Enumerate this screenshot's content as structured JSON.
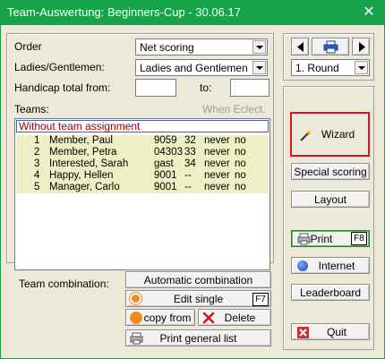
{
  "window": {
    "title": "Team-Auswertung: Beginners-Cup - 30.06.17",
    "close_glyph": "✕"
  },
  "form": {
    "order_label": "Order",
    "order_value": "Net scoring",
    "ladies_label": "Ladies/Gentlemen:",
    "ladies_value": "Ladies and Gentlemen",
    "handicap_label": "Handicap total from:",
    "handicap_from": "",
    "to_label": "to:",
    "handicap_to": "",
    "teams_label": "Teams:",
    "when_eclect_label": "When Eclect."
  },
  "teams_list": {
    "header": "Without team assignment",
    "rows": [
      {
        "num": "1",
        "name": "Member, Paul",
        "id": "9059",
        "hcp": "32",
        "status": "never",
        "flag": "no"
      },
      {
        "num": "2",
        "name": "Member, Petra",
        "id": "04303",
        "hcp": "33",
        "status": "never",
        "flag": "no"
      },
      {
        "num": "3",
        "name": "Interested, Sarah",
        "id": "gast",
        "hcp": "34",
        "status": "never",
        "flag": "no"
      },
      {
        "num": "4",
        "name": "Happy, Hellen",
        "id": "9001",
        "hcp": "--",
        "status": "never",
        "flag": "no"
      },
      {
        "num": "5",
        "name": "Manager, Carlo",
        "id": "9001",
        "hcp": "--",
        "status": "never",
        "flag": "no"
      }
    ]
  },
  "combination": {
    "label": "Team combination:",
    "automatic": "Automatic combination",
    "edit_single": "Edit single",
    "edit_key": "F7",
    "copy_from": "copy from",
    "delete": "Delete",
    "print_general": "Print general list"
  },
  "side": {
    "round_value": "1. Round",
    "wizard": "Wizard",
    "special_scoring": "Special scoring",
    "layout": "Layout",
    "print": "Print",
    "print_key": "F8",
    "internet": "Internet",
    "leaderboard": "Leaderboard",
    "quit": "Quit"
  },
  "colors": {
    "title_bar": "#17a34a",
    "highlight_rows": "#efefc6",
    "wizard_border": "#e0151c",
    "header_text": "#a00000"
  }
}
